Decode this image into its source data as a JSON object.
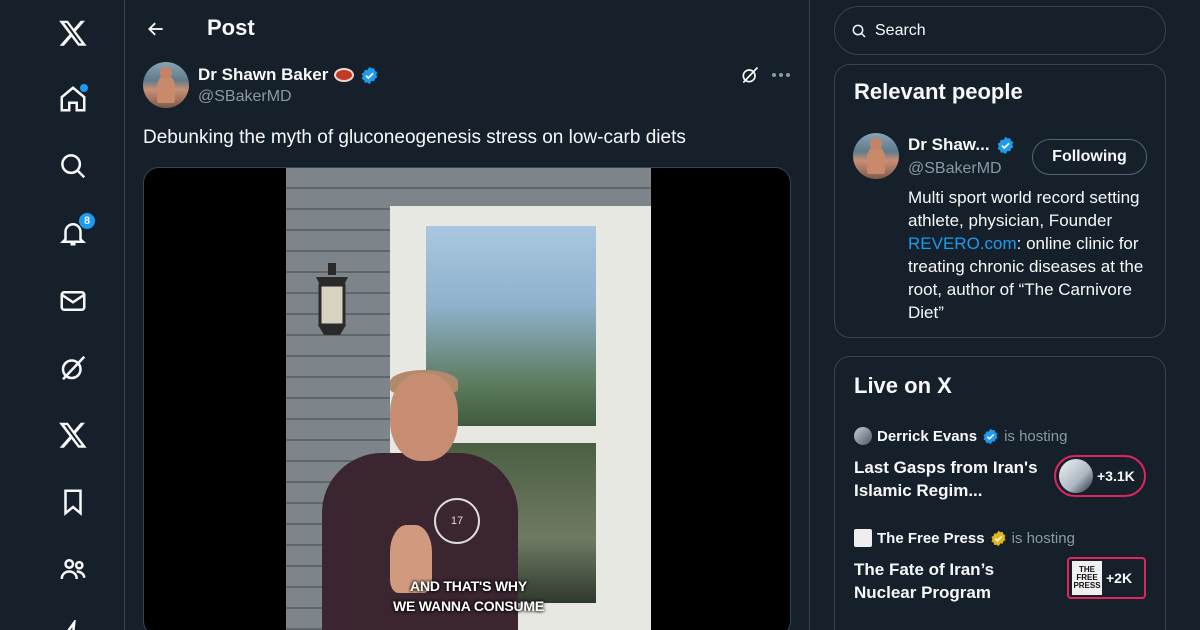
{
  "nav": {
    "notifications_count": "8",
    "items": [
      "x-logo",
      "home",
      "explore",
      "notifications",
      "messages",
      "grok",
      "premium",
      "bookmarks",
      "communities",
      "verified-orgs"
    ]
  },
  "header": {
    "title": "Post"
  },
  "post": {
    "author_name": "Dr Shawn Baker",
    "author_handle": "@SBakerMD",
    "text": "Debunking the myth of gluconeogenesis stress on low-carb diets",
    "shirt_logo_text": "17",
    "caption_line1": "AND THAT'S WHY",
    "caption_line2": "WE WANNA CONSUME"
  },
  "search": {
    "placeholder": "Search"
  },
  "relevant_people": {
    "title": "Relevant people",
    "person": {
      "name": "Dr Shaw...",
      "handle": "@SBakerMD",
      "button_label": "Following",
      "bio_part1": "Multi sport world record setting athlete, physician, Founder ",
      "bio_link": "REVERO.com",
      "bio_part2": ": online clinic for treating chronic diseases at the root, author of “The Carnivore Diet”"
    }
  },
  "live": {
    "title": "Live on X",
    "spaces": [
      {
        "host": "Derrick Evans",
        "hosting_label": "is hosting",
        "title": "Last Gasps from Iran's Islamic Regim...",
        "count": "+3.1K"
      },
      {
        "host": "The Free Press",
        "hosting_label": "is hosting",
        "title": "The Fate of Iran’s Nuclear Program",
        "count": "+2K",
        "logo_text": "THE FREE PRESS"
      }
    ]
  },
  "colors": {
    "background": "#15202b",
    "border": "#38444d",
    "accent": "#1d9bf0",
    "live_pill": "#e0245e",
    "muted_text": "#8b98a5"
  }
}
